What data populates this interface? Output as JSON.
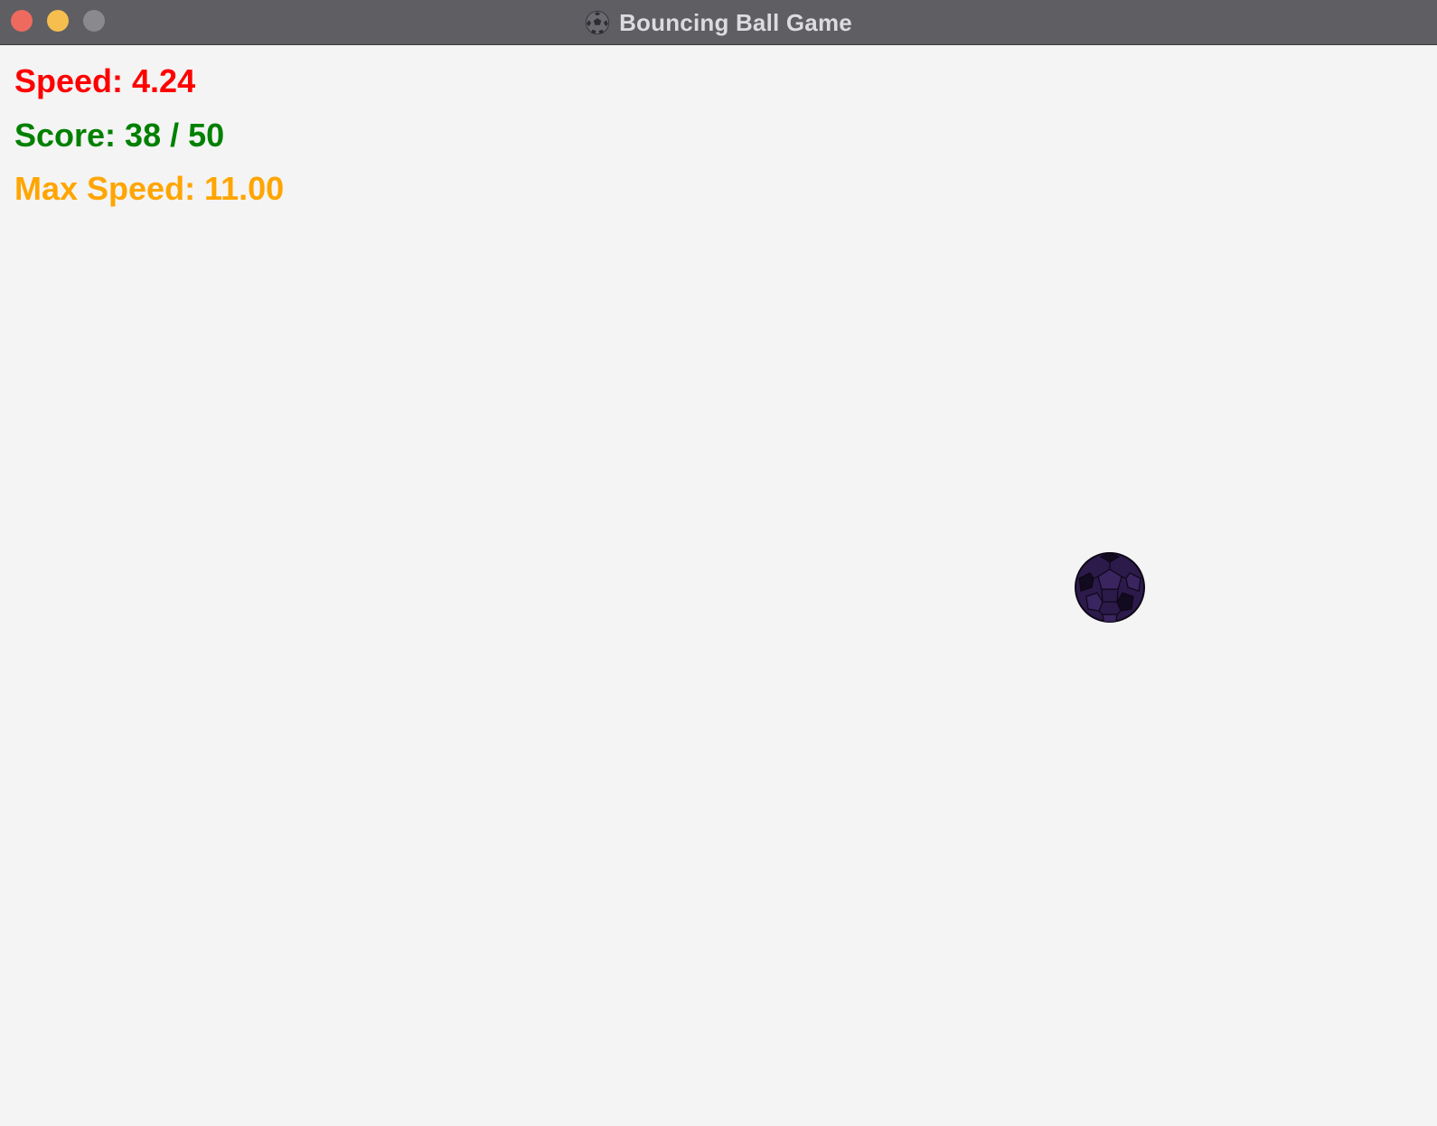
{
  "window": {
    "title": "Bouncing Ball Game",
    "title_icon": "soccer-ball-icon",
    "controls": [
      "close",
      "minimize",
      "zoom"
    ]
  },
  "hud": {
    "speed_text": "Speed: 4.24",
    "score_text": "Score: 38 / 50",
    "max_speed_text": "Max Speed: 11.00",
    "colors": {
      "speed": "#ff0000",
      "score": "#008000",
      "max_speed": "#ffa500"
    }
  },
  "game": {
    "speed": 4.24,
    "score": 38,
    "score_target": 50,
    "max_speed": 11.0,
    "ball": {
      "icon": "soccer-ball-icon",
      "color": "#2c1a4a",
      "patch_color": "#120a1e"
    },
    "background_color": "#f4f4f4"
  }
}
